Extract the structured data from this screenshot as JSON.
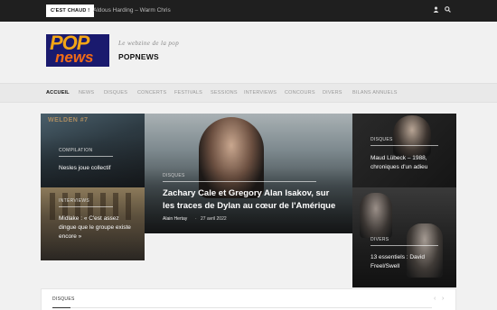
{
  "topbar": {
    "hot_label": "C'EST CHAUD !",
    "ticker": "Aldous Harding – Warm Chris",
    "user_icon": "user-icon",
    "search_icon": "search-icon"
  },
  "header": {
    "logo_pop": "POP",
    "logo_news": "news",
    "tagline": "Le webzine de la pop",
    "site_name": "POPNEWS"
  },
  "nav": {
    "items": [
      "ACCUEIL",
      "NEWS",
      "DISQUES",
      "CONCERTS",
      "FESTIVALS",
      "SESSIONS",
      "INTERVIEWS",
      "CONCOURS",
      "DIVERS",
      "BILANS ANNUELS"
    ],
    "active_index": 0
  },
  "tiles": {
    "top_left": {
      "category": "COMPILATION",
      "title": "Nesles joue collectif",
      "art_text": "WELDEN #7"
    },
    "bottom_left": {
      "category": "INTERVIEWS",
      "title": "Midlake : « C'est assez dingue que le groupe existe encore »"
    },
    "featured": {
      "category": "DISQUES",
      "title": "Zachary Cale et Gregory Alan Isakov, sur les traces de Dylan au cœur de l'Amérique",
      "author": "Alain Hertay",
      "date": "27 avril 2022"
    },
    "top_right": {
      "category": "DISQUES",
      "title": "Maud Lübeck – 1988, chroniques d'un adieu"
    },
    "bottom_right": {
      "category": "DIVERS",
      "title": "13 essentiels : David Freel/Swell"
    }
  },
  "bottom_section": {
    "label": "DISQUES",
    "prev_arrow": "‹",
    "next_arrow": "›"
  },
  "colors": {
    "topbar_bg": "#1f1f1f",
    "logo_bg": "#1a1a6e",
    "logo_pop": "#f2a516",
    "logo_news": "#f26b16"
  }
}
